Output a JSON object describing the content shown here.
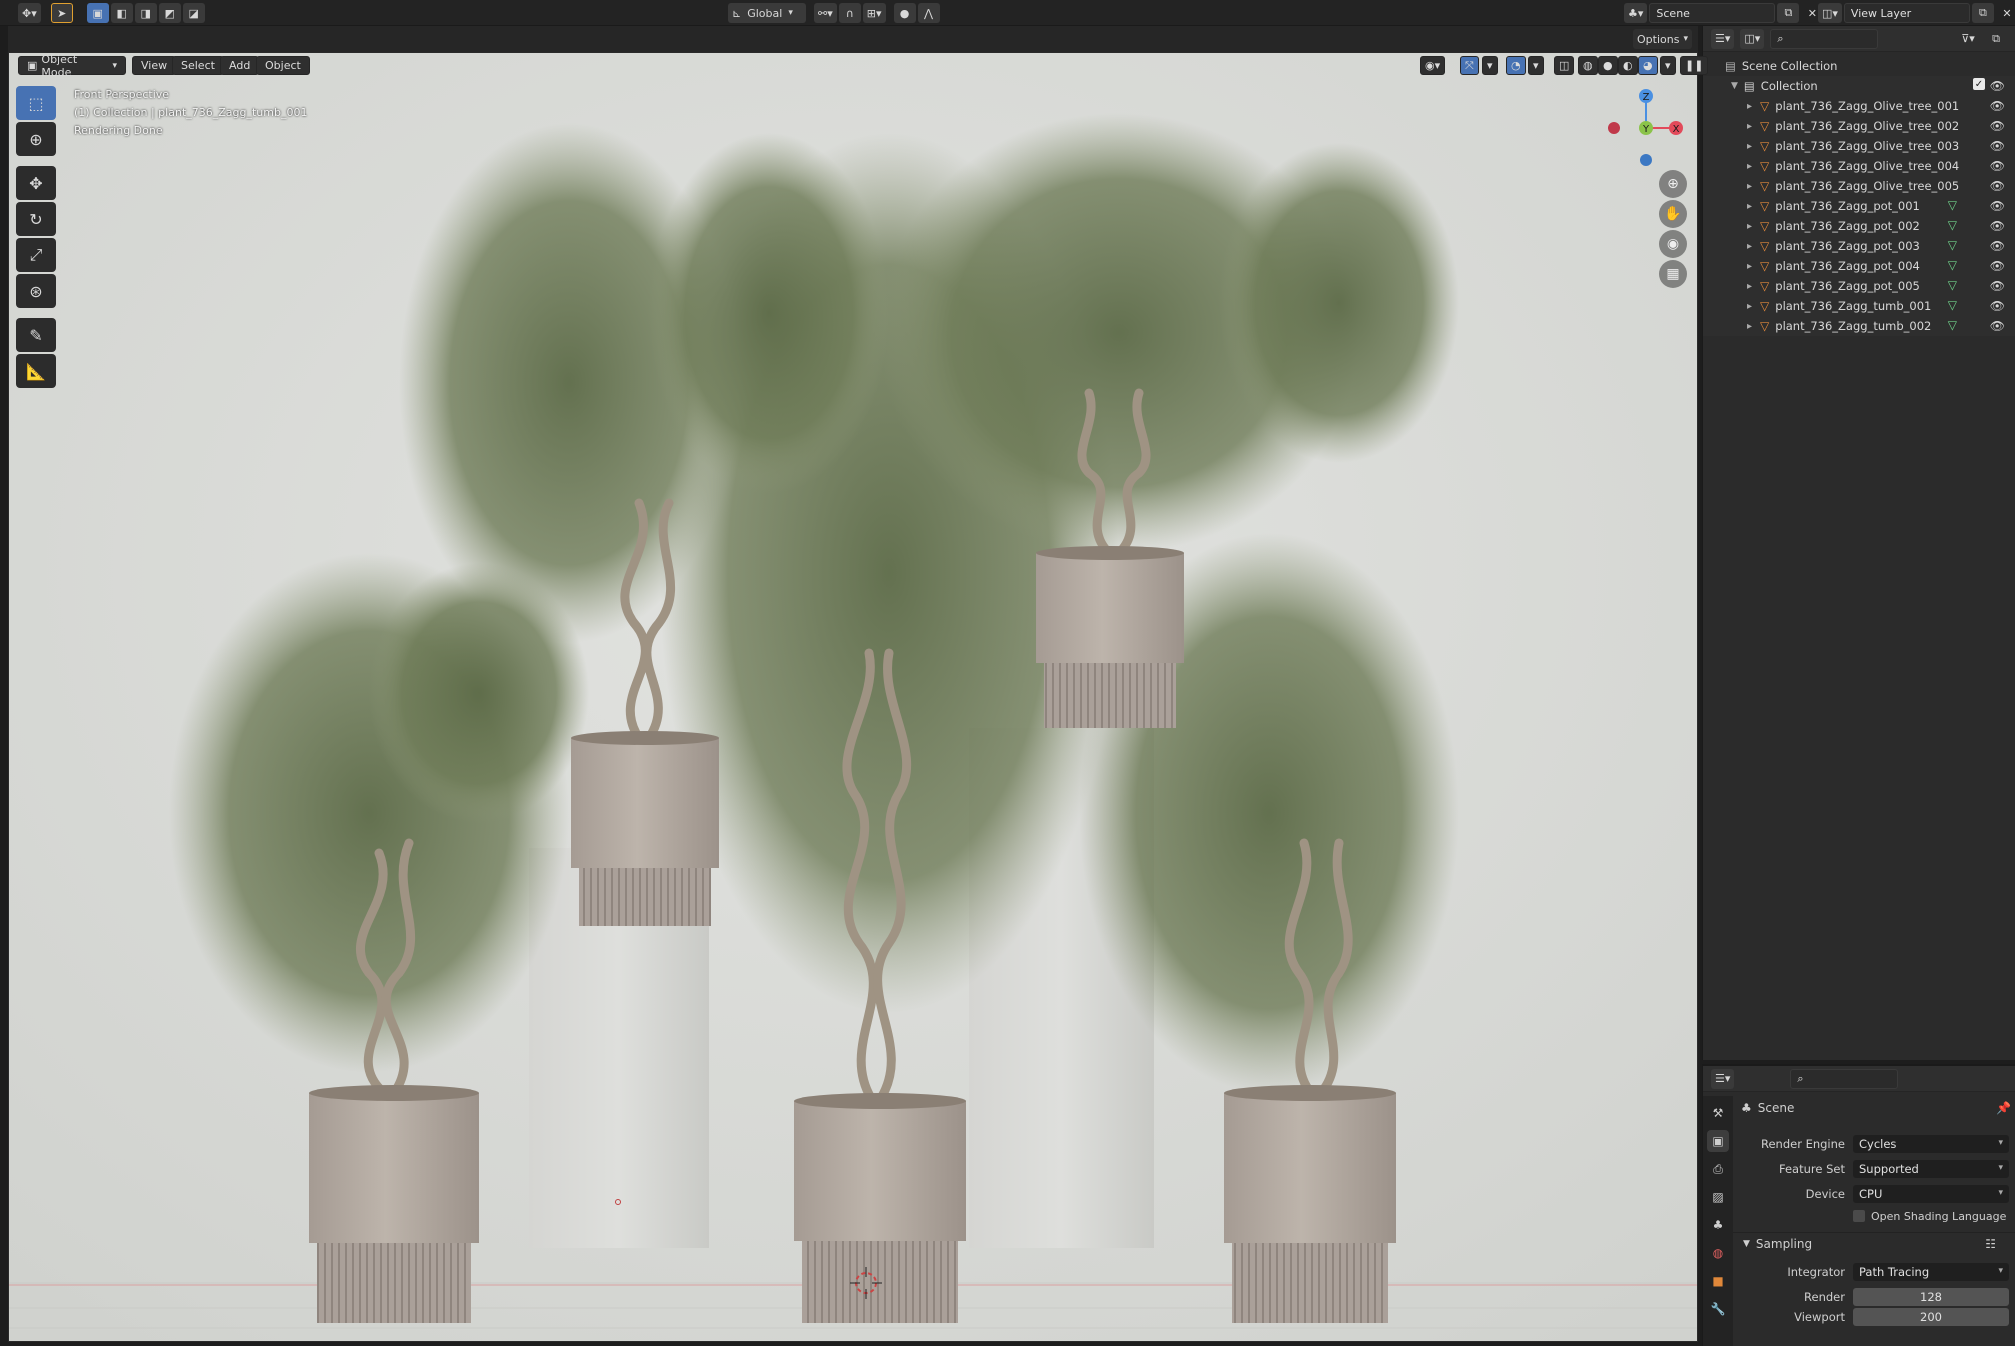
{
  "topbar": {
    "transform_orientation": "Global",
    "scene": "Scene",
    "view_layer": "View Layer",
    "options_label": "Options"
  },
  "viewport_header": {
    "mode": "Object Mode",
    "menus": [
      "View",
      "Select",
      "Add",
      "Object"
    ]
  },
  "viewport_overlay": {
    "view_name": "Front Perspective",
    "active_object": "(1) Collection | plant_736_Zagg_tumb_001",
    "status": "Rendering Done"
  },
  "gizmo": {
    "z": "Z",
    "y": "Y",
    "x": "X"
  },
  "outliner": {
    "root": "Scene Collection",
    "collection": "Collection",
    "items": [
      {
        "name": "plant_736_Zagg_Olive_tree_001",
        "has_mesh_icon": false
      },
      {
        "name": "plant_736_Zagg_Olive_tree_002",
        "has_mesh_icon": false
      },
      {
        "name": "plant_736_Zagg_Olive_tree_003",
        "has_mesh_icon": false
      },
      {
        "name": "plant_736_Zagg_Olive_tree_004",
        "has_mesh_icon": false
      },
      {
        "name": "plant_736_Zagg_Olive_tree_005",
        "has_mesh_icon": false
      },
      {
        "name": "plant_736_Zagg_pot_001",
        "has_mesh_icon": true
      },
      {
        "name": "plant_736_Zagg_pot_002",
        "has_mesh_icon": true
      },
      {
        "name": "plant_736_Zagg_pot_003",
        "has_mesh_icon": true
      },
      {
        "name": "plant_736_Zagg_pot_004",
        "has_mesh_icon": true
      },
      {
        "name": "plant_736_Zagg_pot_005",
        "has_mesh_icon": true
      },
      {
        "name": "plant_736_Zagg_tumb_001",
        "has_mesh_icon": true
      },
      {
        "name": "plant_736_Zagg_tumb_002",
        "has_mesh_icon": true
      }
    ]
  },
  "properties": {
    "context": "Scene",
    "render_engine_label": "Render Engine",
    "render_engine": "Cycles",
    "feature_set_label": "Feature Set",
    "feature_set": "Supported",
    "device_label": "Device",
    "device": "CPU",
    "osl_label": "Open Shading Language",
    "sampling_label": "Sampling",
    "integrator_label": "Integrator",
    "integrator": "Path Tracing",
    "render_label": "Render",
    "render_samples": "128",
    "viewport_label": "Viewport",
    "viewport_samples": "200"
  },
  "colors": {
    "accent": "#4772b3",
    "object_icon": "#e0883a",
    "mesh_icon": "#6fd08a",
    "axis_x": "#e24a5a",
    "axis_y": "#8bc34a",
    "axis_z": "#4a90e2"
  }
}
